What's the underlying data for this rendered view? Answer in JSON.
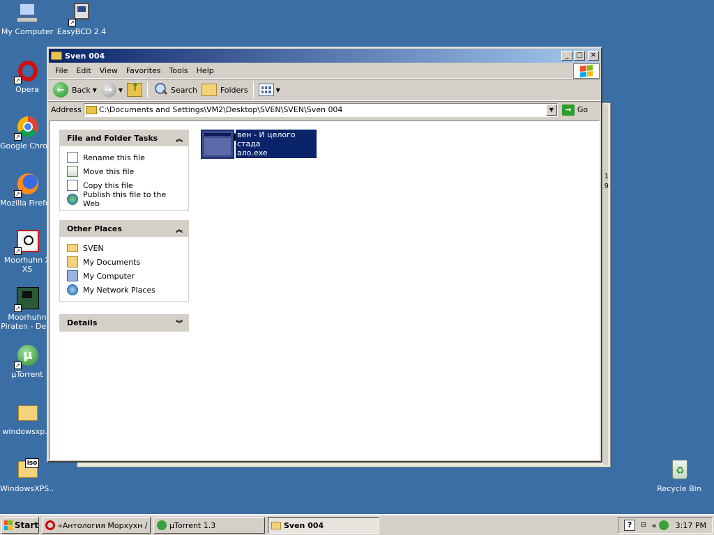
{
  "desktop": {
    "icons": [
      {
        "label": "My Computer",
        "icon": "my-computer-icon"
      },
      {
        "label": "EasyBCD 2.4",
        "icon": "easybcd-icon"
      },
      {
        "label": "Opera",
        "icon": "opera-icon"
      },
      {
        "label": "Google Chrome",
        "icon": "chrome-icon"
      },
      {
        "label": "Mozilla Firefox",
        "icon": "firefox-icon"
      },
      {
        "label": "Moorhuhn X XS",
        "icon": "moorhuhn-icon"
      },
      {
        "label": "Moorhuhn Piraten - De...",
        "icon": "moorhuhn-piraten-icon"
      },
      {
        "label": "µTorrent",
        "icon": "utorrent-icon"
      },
      {
        "label": "windowsxp...",
        "icon": "folder-icon"
      },
      {
        "label": "WindowsXPS...",
        "icon": "iso-icon"
      },
      {
        "label": "Recycle Bin",
        "icon": "recycle-bin-icon"
      }
    ]
  },
  "window": {
    "title": "Sven 004",
    "menu": [
      "File",
      "Edit",
      "View",
      "Favorites",
      "Tools",
      "Help"
    ],
    "toolbar": {
      "back": "Back",
      "search": "Search",
      "folders": "Folders"
    },
    "address": {
      "label": "Address",
      "value": "C:\\Documents and Settings\\VM2\\Desktop\\SVEN\\SVEN\\Sven 004",
      "go": "Go"
    },
    "panels": {
      "file_tasks": {
        "title": "File and Folder Tasks",
        "items": [
          "Rename this file",
          "Move this file",
          "Copy this file",
          "Publish this file to the Web"
        ]
      },
      "other_places": {
        "title": "Other Places",
        "items": [
          "SVEN",
          "My Documents",
          "My Computer",
          "My Network Places"
        ]
      },
      "details": {
        "title": "Details"
      }
    },
    "file": {
      "name": "Свен - И целого стада мало.exe",
      "display_line1": "вен - И целого стада",
      "display_line2": "ало.exe"
    }
  },
  "taskbar": {
    "start": "Start",
    "tasks": [
      "«Антология Морхухн / ...",
      "µTorrent 1.3",
      "Sven 004"
    ],
    "clock": "3:17 PM",
    "quick": "«"
  },
  "background_fragments": [
    "1",
    "9"
  ]
}
